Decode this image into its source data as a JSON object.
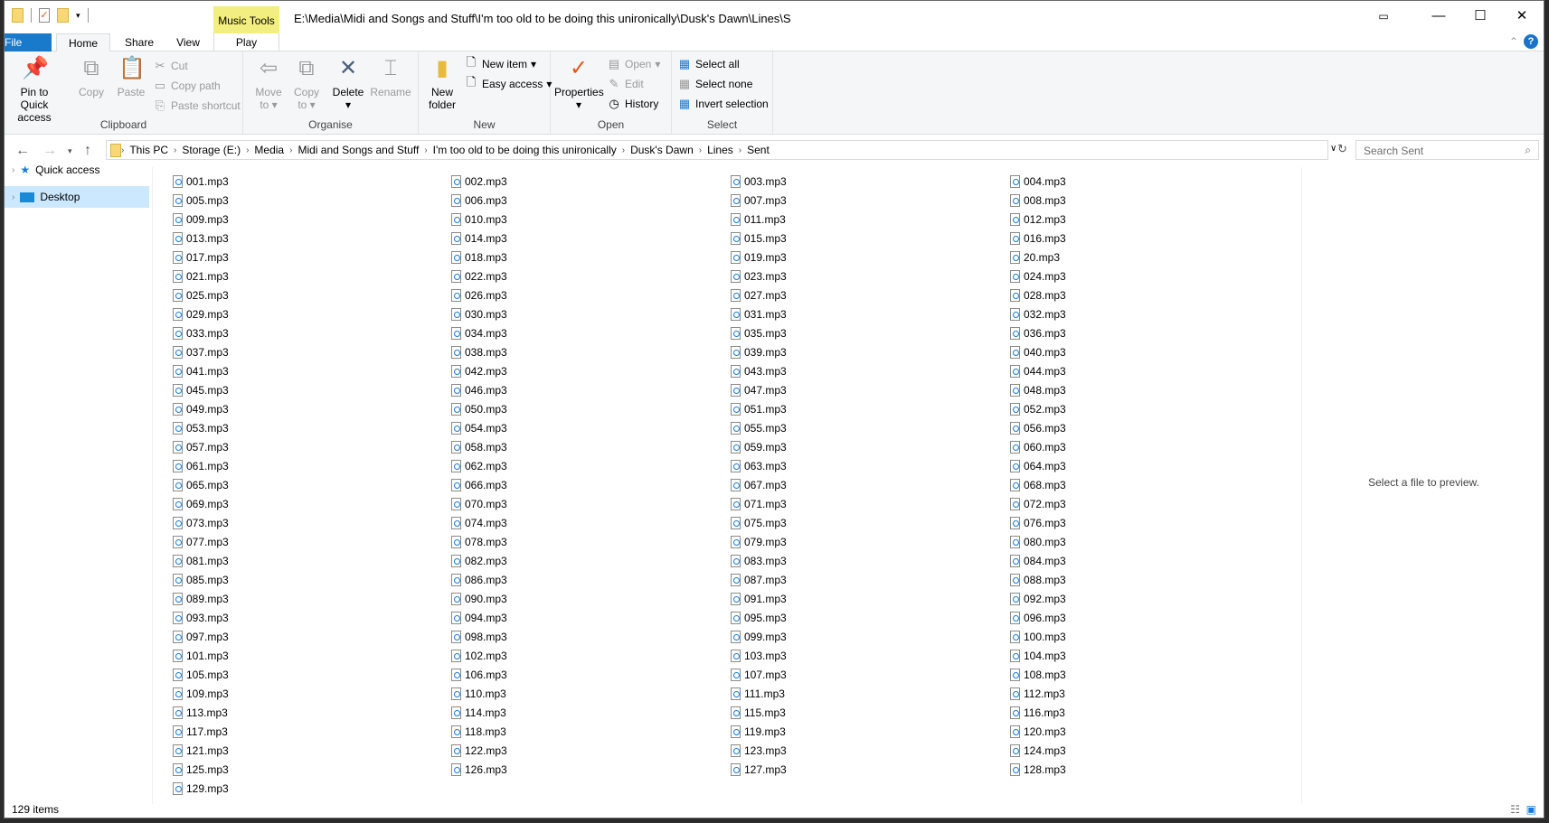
{
  "title_path": "E:\\Media\\Midi and Songs and Stuff\\I'm too old to be doing this unironically\\Dusk's Dawn\\Lines\\S",
  "context_tab": "Music Tools",
  "tabs": [
    "File",
    "Home",
    "Share",
    "View",
    "Play"
  ],
  "ribbon": {
    "clipboard": {
      "label": "Clipboard",
      "pin": "Pin to Quick access",
      "copy": "Copy",
      "paste": "Paste",
      "cut": "Cut",
      "copy_path": "Copy path",
      "paste_shortcut": "Paste shortcut"
    },
    "organise": {
      "label": "Organise",
      "move_to": "Move to",
      "copy_to": "Copy to",
      "delete": "Delete",
      "rename": "Rename"
    },
    "new": {
      "label": "New",
      "new_folder": "New folder",
      "new_item": "New item",
      "easy_access": "Easy access"
    },
    "open": {
      "label": "Open",
      "properties": "Properties",
      "open": "Open",
      "edit": "Edit",
      "history": "History"
    },
    "select": {
      "label": "Select",
      "select_all": "Select all",
      "select_none": "Select none",
      "invert": "Invert selection"
    }
  },
  "breadcrumb": [
    "This PC",
    "Storage (E:)",
    "Media",
    "Midi and Songs and Stuff",
    "I'm too old to be doing this unironically",
    "Dusk's Dawn",
    "Lines",
    "Sent"
  ],
  "search_placeholder": "Search Sent",
  "nav": {
    "quick_access": "Quick access",
    "desktop": "Desktop"
  },
  "files": [
    "001.mp3",
    "002.mp3",
    "003.mp3",
    "004.mp3",
    "005.mp3",
    "006.mp3",
    "007.mp3",
    "008.mp3",
    "009.mp3",
    "010.mp3",
    "011.mp3",
    "012.mp3",
    "013.mp3",
    "014.mp3",
    "015.mp3",
    "016.mp3",
    "017.mp3",
    "018.mp3",
    "019.mp3",
    "20.mp3",
    "021.mp3",
    "022.mp3",
    "023.mp3",
    "024.mp3",
    "025.mp3",
    "026.mp3",
    "027.mp3",
    "028.mp3",
    "029.mp3",
    "030.mp3",
    "031.mp3",
    "032.mp3",
    "033.mp3",
    "034.mp3",
    "035.mp3",
    "036.mp3",
    "037.mp3",
    "038.mp3",
    "039.mp3",
    "040.mp3",
    "041.mp3",
    "042.mp3",
    "043.mp3",
    "044.mp3",
    "045.mp3",
    "046.mp3",
    "047.mp3",
    "048.mp3",
    "049.mp3",
    "050.mp3",
    "051.mp3",
    "052.mp3",
    "053.mp3",
    "054.mp3",
    "055.mp3",
    "056.mp3",
    "057.mp3",
    "058.mp3",
    "059.mp3",
    "060.mp3",
    "061.mp3",
    "062.mp3",
    "063.mp3",
    "064.mp3",
    "065.mp3",
    "066.mp3",
    "067.mp3",
    "068.mp3",
    "069.mp3",
    "070.mp3",
    "071.mp3",
    "072.mp3",
    "073.mp3",
    "074.mp3",
    "075.mp3",
    "076.mp3",
    "077.mp3",
    "078.mp3",
    "079.mp3",
    "080.mp3",
    "081.mp3",
    "082.mp3",
    "083.mp3",
    "084.mp3",
    "085.mp3",
    "086.mp3",
    "087.mp3",
    "088.mp3",
    "089.mp3",
    "090.mp3",
    "091.mp3",
    "092.mp3",
    "093.mp3",
    "094.mp3",
    "095.mp3",
    "096.mp3",
    "097.mp3",
    "098.mp3",
    "099.mp3",
    "100.mp3",
    "101.mp3",
    "102.mp3",
    "103.mp3",
    "104.mp3",
    "105.mp3",
    "106.mp3",
    "107.mp3",
    "108.mp3",
    "109.mp3",
    "110.mp3",
    "111.mp3",
    "112.mp3",
    "113.mp3",
    "114.mp3",
    "115.mp3",
    "116.mp3",
    "117.mp3",
    "118.mp3",
    "119.mp3",
    "120.mp3",
    "121.mp3",
    "122.mp3",
    "123.mp3",
    "124.mp3",
    "125.mp3",
    "126.mp3",
    "127.mp3",
    "128.mp3",
    "129.mp3"
  ],
  "preview_text": "Select a file to preview.",
  "status": "129 items"
}
